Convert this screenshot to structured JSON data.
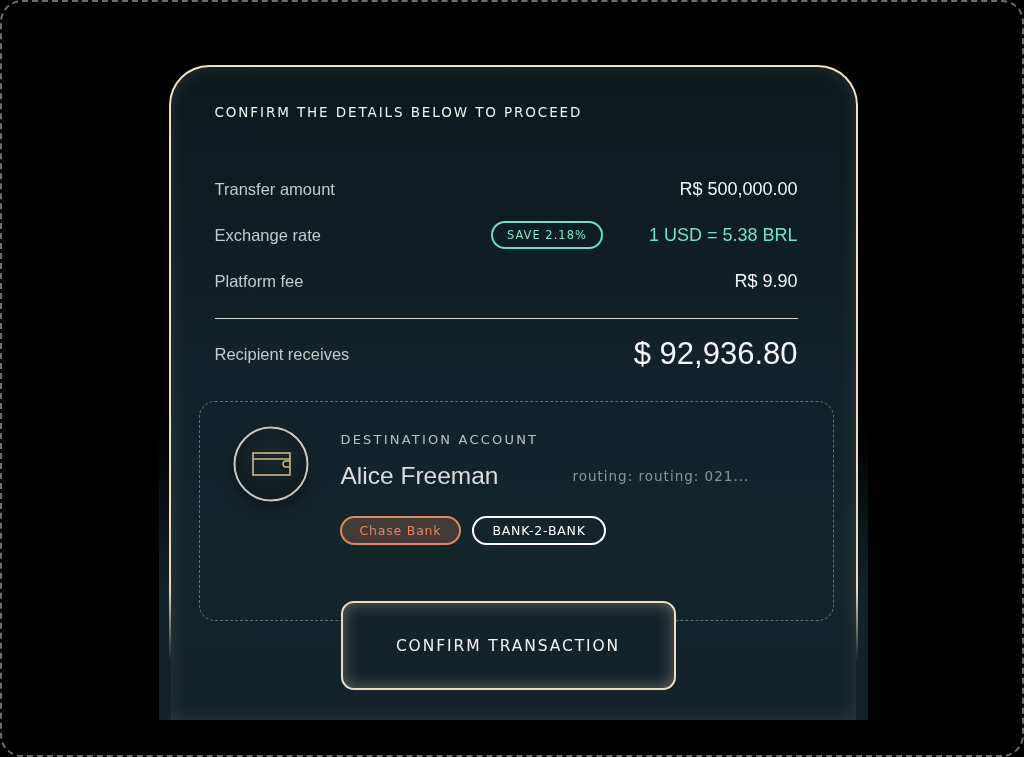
{
  "heading": "CONFIRM THE DETAILS BELOW TO PROCEED",
  "rows": [
    {
      "label": "Transfer amount",
      "value": "R$ 500,000.00",
      "kind": "plain"
    },
    {
      "label": "Exchange rate",
      "badge": "SAVE 2.18%",
      "value": "1 USD = 5.38 BRL",
      "kind": "rate"
    },
    {
      "label": "Platform fee",
      "value": "R$ 9.90",
      "kind": "plain"
    }
  ],
  "total": {
    "label": "Recipient receives",
    "value": "$ 92,936.80"
  },
  "destination": {
    "title": "DESTINATION ACCOUNT",
    "name": "Alice Freeman",
    "routing": "routing: routing: 021...",
    "tags": [
      {
        "label": "Chase Bank",
        "kind": "bank",
        "color": "#e8845c"
      },
      {
        "label": "BANK-2-BANK",
        "kind": "rail",
        "color": "#ffffff"
      }
    ]
  },
  "confirm_button": "CONFIRM TRANSACTION"
}
